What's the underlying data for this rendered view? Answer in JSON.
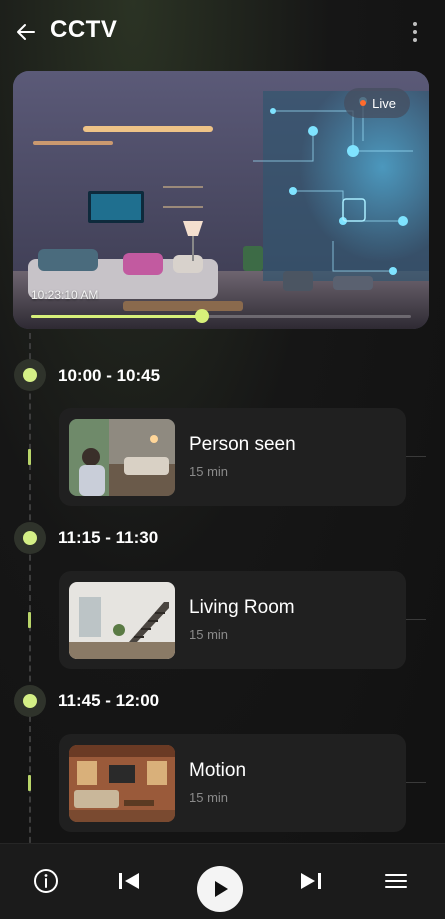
{
  "header": {
    "title": "CCTV",
    "back_icon": "arrow-left-icon",
    "menu_icon": "more-vertical-icon"
  },
  "video": {
    "live_label": "Live",
    "timestamp": "10:23:10 AM",
    "progress": 0.45,
    "accent": "#d7f07a",
    "live_dot_color": "#ff6b2d"
  },
  "timeline": [
    {
      "range": "10:00 - 10:45",
      "event": {
        "title": "Person seen",
        "duration": "15 min"
      }
    },
    {
      "range": "11:15 - 11:30",
      "event": {
        "title": "Living Room",
        "duration": "15 min"
      }
    },
    {
      "range": "11:45 - 12:00",
      "event": {
        "title": "Motion",
        "duration": "15 min"
      }
    }
  ],
  "controls": {
    "items": [
      "info-icon",
      "skip-previous-icon",
      "play-icon",
      "skip-next-icon",
      "menu-icon"
    ]
  }
}
